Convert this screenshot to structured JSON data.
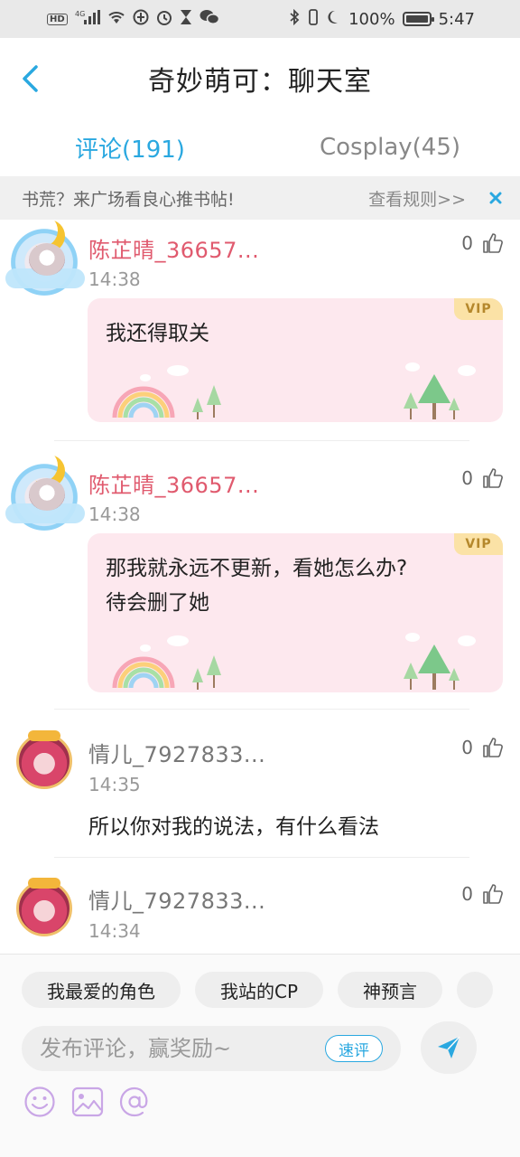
{
  "status_bar": {
    "network": "4G",
    "battery": "100%",
    "time": "5:47",
    "battery_level": 1.0
  },
  "header": {
    "title": "奇妙萌可：聊天室"
  },
  "tabs": [
    {
      "label": "评论(191)",
      "active": true
    },
    {
      "label": "Cosplay(45)",
      "active": false
    }
  ],
  "notice": {
    "text": "书荒？来广场看良心推书帖!",
    "link": "查看规则>>"
  },
  "comments": [
    {
      "username": "陈芷晴_36657...",
      "time": "14:38",
      "likes": "0",
      "text": "我还得取关",
      "vip": "VIP"
    },
    {
      "username": "陈芷晴_36657...",
      "time": "14:38",
      "likes": "0",
      "text": "那我就永远不更新，看她怎么办?\n待会删了她",
      "vip": "VIP"
    },
    {
      "username": "情儿_7927833...",
      "time": "14:35",
      "likes": "0",
      "text": "所以你对我的说法，有什么看法"
    },
    {
      "username": "情儿_7927833...",
      "time": "14:34",
      "likes": "0"
    }
  ],
  "topics": [
    "我最爱的角色",
    "我站的CP",
    "神预言"
  ],
  "input": {
    "placeholder": "发布评论，赢奖励~",
    "quick_review": "速评"
  },
  "colors": {
    "accent": "#2aa8e0",
    "vip_username": "#e05a6e",
    "bubble_bg": "#fde8ee",
    "tool_icons": "#c9a6e6"
  }
}
